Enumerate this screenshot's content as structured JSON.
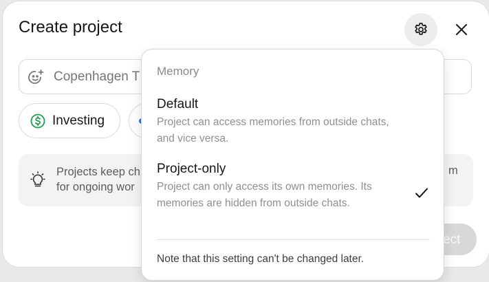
{
  "dialog": {
    "title": "Create project",
    "name_placeholder": "Copenhagen T",
    "chips": [
      {
        "label": "Investing",
        "icon": "dollar-circle-icon",
        "color": "#1e9e4a"
      }
    ],
    "info_text_line1": "Projects keep ch",
    "info_text_line2": "for ongoing wor",
    "info_text_tail": "m",
    "create_label": "ect"
  },
  "memory_menu": {
    "header": "Memory",
    "options": [
      {
        "label": "Default",
        "description": "Project can access memories from outside chats, and vice versa.",
        "selected": false
      },
      {
        "label": "Project-only",
        "description": "Project can only access its own memories. Its memories are hidden from outside chats.",
        "selected": true
      }
    ],
    "note": "Note that this setting can't be changed later."
  },
  "colors": {
    "background": "#e9e9e9",
    "accent_green": "#1e9e4a",
    "secondary_dot": "#2a6fd8"
  }
}
